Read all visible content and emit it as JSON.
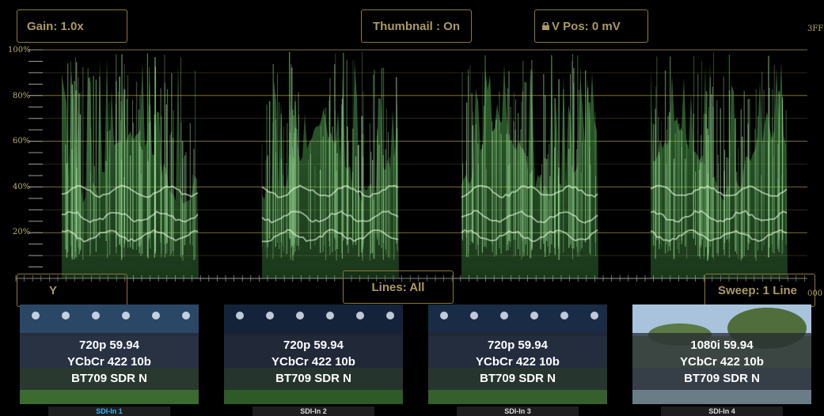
{
  "scope": {
    "gain_label": "Gain: 1.0x",
    "thumbnail_label": "Thumbnail : On",
    "vpos_label": "V Pos: 0 mV",
    "lines_label": "Lines: All",
    "sweep_label": "Sweep: 1 Line",
    "channel_label": "Y",
    "top_right_label": "3FF",
    "bottom_right_label": "000",
    "axis_labels": [
      "100%",
      "80%",
      "60%",
      "40%",
      "20%"
    ],
    "trace_color": "#59b858",
    "graticule_color": "#8a7a3e"
  },
  "inputs": [
    {
      "format": "720p 59.94",
      "color_space": "YCbCr 422 10b",
      "transfer": "BT709 SDR N",
      "tab": "SDI-In 1",
      "active": true
    },
    {
      "format": "720p 59.94",
      "color_space": "YCbCr 422 10b",
      "transfer": "BT709 SDR N",
      "tab": "SDI-In 2",
      "active": false
    },
    {
      "format": "720p 59.94",
      "color_space": "YCbCr 422 10b",
      "transfer": "BT709 SDR N",
      "tab": "SDI-In 3",
      "active": false
    },
    {
      "format": "1080i 59.94",
      "color_space": "YCbCr 422 10b",
      "transfer": "BT709 SDR N",
      "tab": "SDI-In 4",
      "active": false
    }
  ],
  "colors": {
    "active_tab": "#33b6ff"
  },
  "icons": {
    "lock": "lock-icon"
  }
}
